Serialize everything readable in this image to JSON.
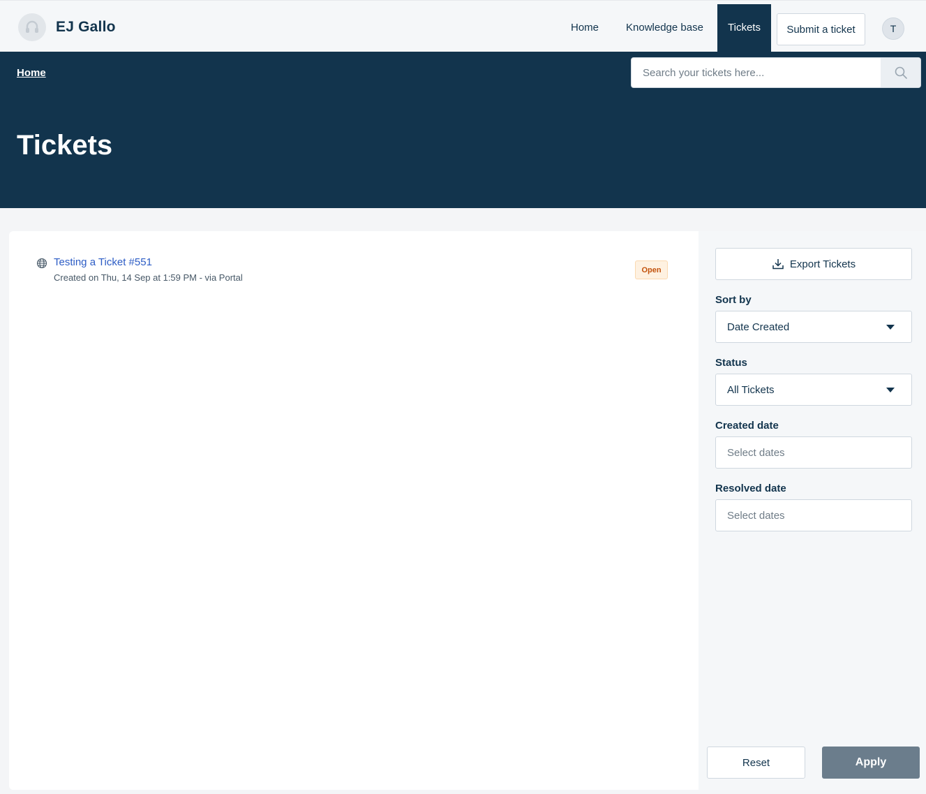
{
  "header": {
    "brand": "EJ Gallo",
    "nav": {
      "home": "Home",
      "knowledge_base": "Knowledge base",
      "tickets": "Tickets",
      "submit_ticket": "Submit a ticket"
    },
    "avatar_initial": "T"
  },
  "hero": {
    "breadcrumb": "Home",
    "search_placeholder": "Search your tickets here...",
    "title": "Tickets"
  },
  "tickets": [
    {
      "title": "Testing a Ticket #551",
      "meta": "Created on Thu, 14 Sep at 1:59 PM - via Portal",
      "status": "Open",
      "icon": "globe-icon"
    }
  ],
  "sidebar": {
    "export_label": "Export Tickets",
    "sort_label": "Sort by",
    "sort_value": "Date Created",
    "status_label": "Status",
    "status_value": "All Tickets",
    "created_label": "Created date",
    "created_placeholder": "Select dates",
    "resolved_label": "Resolved date",
    "resolved_placeholder": "Select dates",
    "reset_label": "Reset",
    "apply_label": "Apply"
  },
  "colors": {
    "primary": "#12344d",
    "link": "#2c5cc5",
    "status_open_bg": "#fef1e1",
    "status_open_text": "#c3520c",
    "apply_disabled": "#6b7d8c"
  }
}
